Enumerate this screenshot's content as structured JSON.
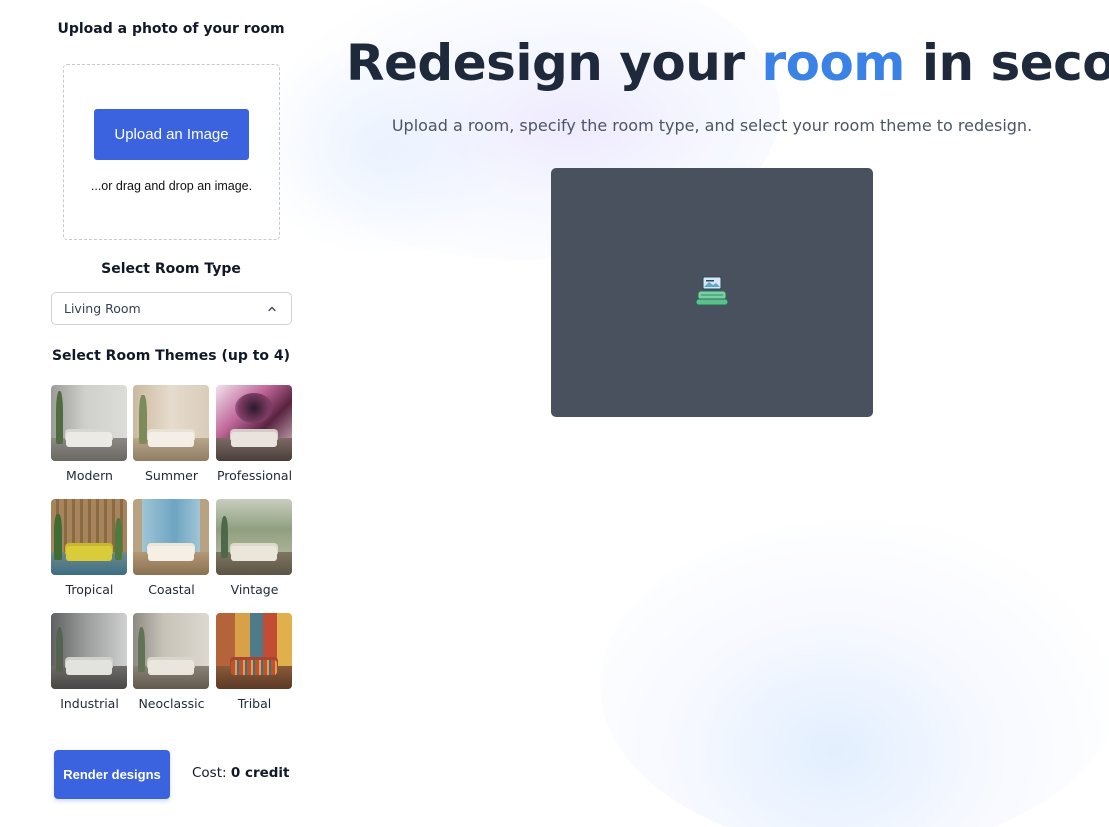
{
  "sidebar": {
    "upload_title": "Upload a photo of your room",
    "upload_button": "Upload an Image",
    "drag_text": "...or drag and drop an image.",
    "room_type_title": "Select Room Type",
    "room_type_value": "Living Room",
    "themes_title": "Select Room Themes (up to 4)",
    "themes": [
      {
        "label": "Modern"
      },
      {
        "label": "Summer"
      },
      {
        "label": "Professional"
      },
      {
        "label": "Tropical"
      },
      {
        "label": "Coastal"
      },
      {
        "label": "Vintage"
      },
      {
        "label": "Industrial"
      },
      {
        "label": "Neoclassic"
      },
      {
        "label": "Tribal"
      }
    ],
    "render_button": "Render designs",
    "cost_label": "Cost:",
    "cost_value": "0 credit"
  },
  "main": {
    "headline_part1": "Redesign your",
    "headline_accent": "room",
    "headline_part2": "in seconds",
    "subtitle": "Upload a room, specify the room type, and select your room theme to redesign."
  },
  "colors": {
    "primary": "#3b63e0",
    "accent": "#3b82e6",
    "preview_bg": "#4a515e"
  },
  "icons": [
    "chevron-up-icon",
    "image-placeholder-icon"
  ]
}
